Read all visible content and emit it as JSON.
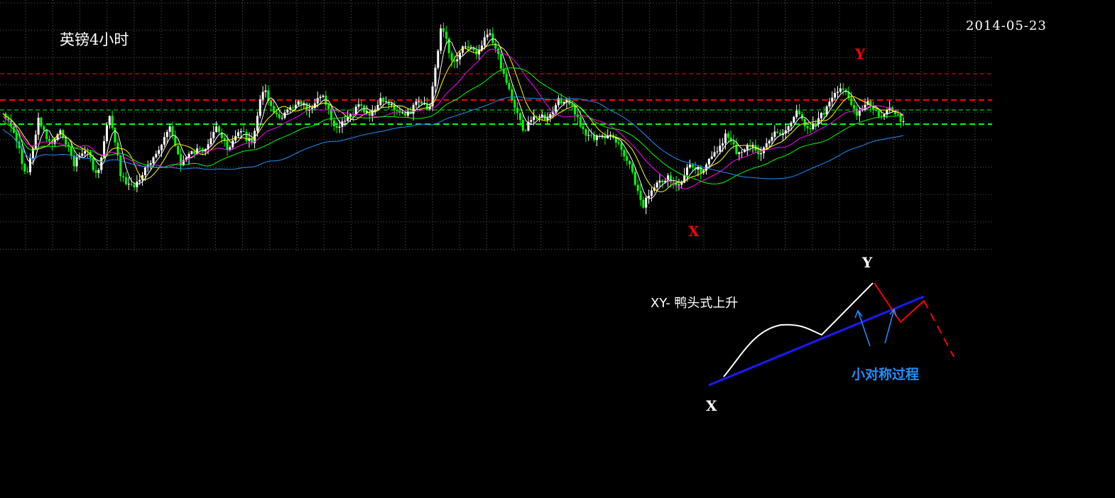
{
  "chart": {
    "title": "英镑4小时",
    "date": "2014-05-23",
    "markers": {
      "x_top": "X",
      "y_top": "Y"
    }
  },
  "diagram": {
    "pattern_label": "XY- 鸭头式上升",
    "process_label": "小对称过程",
    "x_label": "X",
    "y_label": "Y"
  },
  "colors": {
    "background": "#000000",
    "grid": "#5a5a5a",
    "bull": "#ffffff",
    "bear": "#00ff00",
    "ma1": "#ffffff",
    "ma2": "#ffff00",
    "ma3": "#ff00ff",
    "ma4": "#00ff00",
    "ma5": "#1e90ff",
    "level_red": "#ff0000",
    "level_green": "#00ff00",
    "trend_blue": "#1a1aff",
    "arrow_blue": "#1e90ff"
  },
  "chart_data": {
    "type": "candlestick",
    "price_path": [
      160,
      190,
      250,
      170,
      205,
      185,
      230,
      210,
      250,
      160,
      250,
      265,
      240,
      220,
      175,
      230,
      215,
      210,
      175,
      215,
      180,
      205,
      120,
      165,
      160,
      140,
      160,
      130,
      185,
      170,
      150,
      165,
      140,
      150,
      165,
      145,
      155,
      35,
      90,
      60,
      75,
      40,
      90,
      140,
      185,
      160,
      170,
      140,
      150,
      185,
      195,
      190,
      205,
      240,
      290,
      265,
      250,
      265,
      230,
      240,
      220,
      190,
      215,
      205,
      215,
      190,
      185,
      160,
      180,
      165,
      140,
      120,
      165,
      145,
      165,
      155,
      175
    ],
    "levels": [
      {
        "value": 104,
        "color": "red",
        "style": "dash"
      },
      {
        "value": 141,
        "color": "red",
        "style": "dash-bold"
      },
      {
        "value": 155,
        "color": "green",
        "style": "dash"
      },
      {
        "value": 175,
        "color": "green",
        "style": "dash-bold"
      }
    ]
  }
}
